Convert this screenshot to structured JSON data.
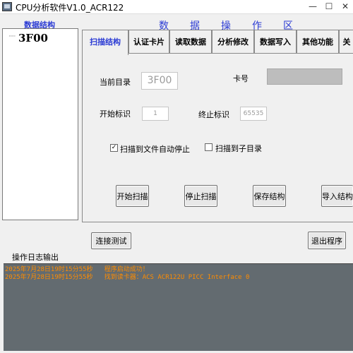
{
  "window": {
    "title": "CPU分析软件V1.0_ACR122",
    "minimize": "—",
    "maximize": "☐",
    "close": "✕"
  },
  "left_header": "数据结构",
  "right_header": "数据操作区",
  "tree": {
    "dots": "·····",
    "node": "3F00"
  },
  "tabs": [
    {
      "label": "扫描结构"
    },
    {
      "label": "认证卡片"
    },
    {
      "label": "读取数据"
    },
    {
      "label": "分析修改"
    },
    {
      "label": "数据写入"
    },
    {
      "label": "其他功能"
    },
    {
      "label": "关"
    }
  ],
  "scan_panel": {
    "current_dir_label": "当前目录",
    "current_dir_value": "3F00",
    "card_no_label": "卡号",
    "card_no_value": "",
    "start_id_label": "开始标识",
    "start_id_value": "1",
    "end_id_label": "终止标识",
    "end_id_value": "65535",
    "auto_stop_label": "扫描到文件自动停止",
    "auto_stop_checked": "✓",
    "scan_sub_label": "扫描到子目录",
    "start_scan": "开始扫描",
    "stop_scan": "停止扫描",
    "save_struct": "保存结构",
    "import_struct": "导入结构"
  },
  "bottom": {
    "connect_test": "连接测试",
    "exit": "退出程序",
    "log_label": "操作日志输出"
  },
  "log_lines": [
    "2025年7月28日19时15分55秒   程序启动成功！",
    "2025年7月28日19时15分55秒   找到读卡器：ACS ACR122U PICC Interface 0"
  ]
}
